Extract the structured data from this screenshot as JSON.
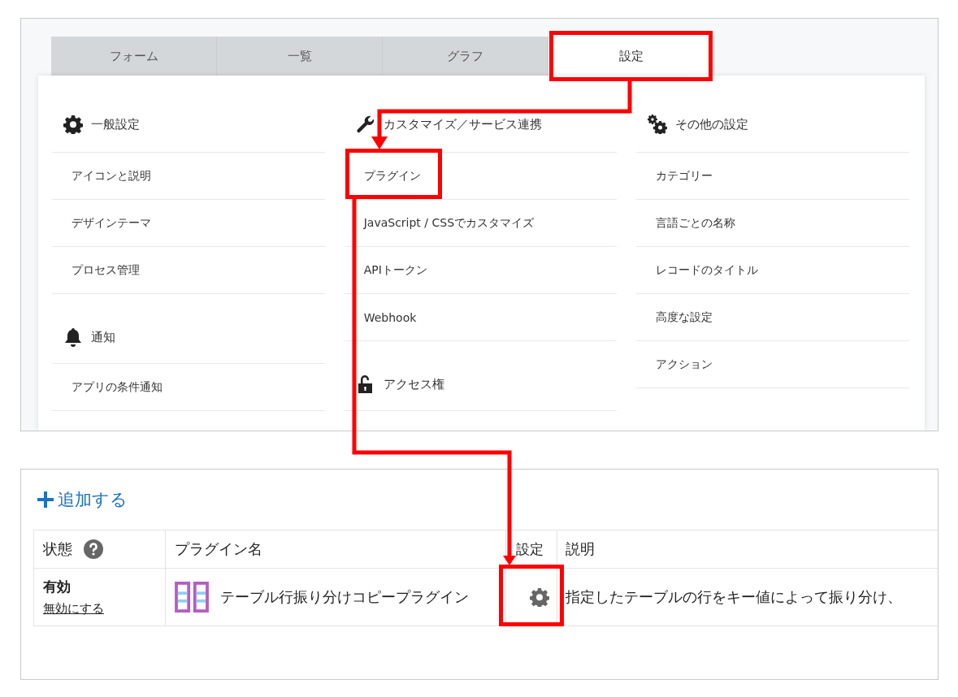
{
  "tabs": [
    {
      "label": "フォーム",
      "selected": false
    },
    {
      "label": "一覧",
      "selected": false
    },
    {
      "label": "グラフ",
      "selected": false
    },
    {
      "label": "設定",
      "selected": true
    }
  ],
  "settings_menu": {
    "columns": [
      {
        "sections": [
          {
            "heading": "一般設定",
            "items": [
              "アイコンと説明",
              "デザインテーマ",
              "プロセス管理"
            ]
          },
          {
            "heading": "通知",
            "items": [
              "アプリの条件通知"
            ]
          }
        ]
      },
      {
        "sections": [
          {
            "heading": "カスタマイズ／サービス連携",
            "items": [
              "プラグイン",
              "JavaScript / CSSでカスタマイズ",
              "APIトークン",
              "Webhook"
            ]
          },
          {
            "heading": "アクセス権"
          }
        ]
      },
      {
        "sections": [
          {
            "heading": "その他の設定",
            "items": [
              "カテゴリー",
              "言語ごとの名称",
              "レコードのタイトル",
              "高度な設定",
              "アクション"
            ]
          }
        ]
      }
    ]
  },
  "add_button": {
    "label": "追加する"
  },
  "plugin_table": {
    "columns": [
      "状態",
      "プラグイン名",
      "設定",
      "説明"
    ],
    "rows": [
      {
        "status": "有効",
        "toggle_link": "無効にする",
        "name": "テーブル行振り分けコピープラグイン",
        "description": "指定したテーブルの行をキー値によって振り分け、"
      }
    ]
  }
}
